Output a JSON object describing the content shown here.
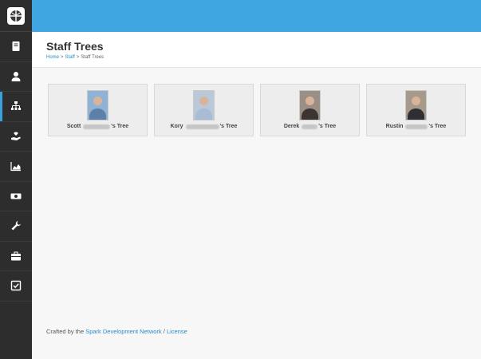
{
  "sidebar": {
    "items": [
      {
        "icon": "book-icon"
      },
      {
        "icon": "person-icon"
      },
      {
        "icon": "org-chart-icon",
        "active": true
      },
      {
        "icon": "hand-heart-icon"
      },
      {
        "icon": "area-chart-icon"
      },
      {
        "icon": "money-icon"
      },
      {
        "icon": "wrench-icon"
      },
      {
        "icon": "briefcase-icon"
      },
      {
        "icon": "checkbox-icon"
      }
    ]
  },
  "header": {
    "title": "Staff Trees",
    "breadcrumb": [
      "Home",
      "Staff",
      "Staff Trees"
    ],
    "breadcrumb_sep": ">"
  },
  "trees": [
    {
      "first": "Scott",
      "suffix": "'s Tree",
      "photo_bg": "#8fb3d6",
      "shirt": "#5d7fa8"
    },
    {
      "first": "Kory",
      "suffix": "'s Tree",
      "photo_bg": "#b9c9d9",
      "shirt": "#a8bcd4"
    },
    {
      "first": "Derek",
      "suffix": "'s Tree",
      "photo_bg": "#9b8f85",
      "shirt": "#3b3430"
    },
    {
      "first": "Rustin",
      "suffix": "'s Tree",
      "photo_bg": "#a89a8a",
      "shirt": "#2f2f33"
    }
  ],
  "footer": {
    "prefix": "Crafted by the ",
    "link_text": "Spark Development Network",
    "divider": " / ",
    "license_text": "License"
  },
  "colors": {
    "topbar": "#3ea5e0",
    "sidebar": "#2d2d2d",
    "link": "#2a8ac9"
  }
}
